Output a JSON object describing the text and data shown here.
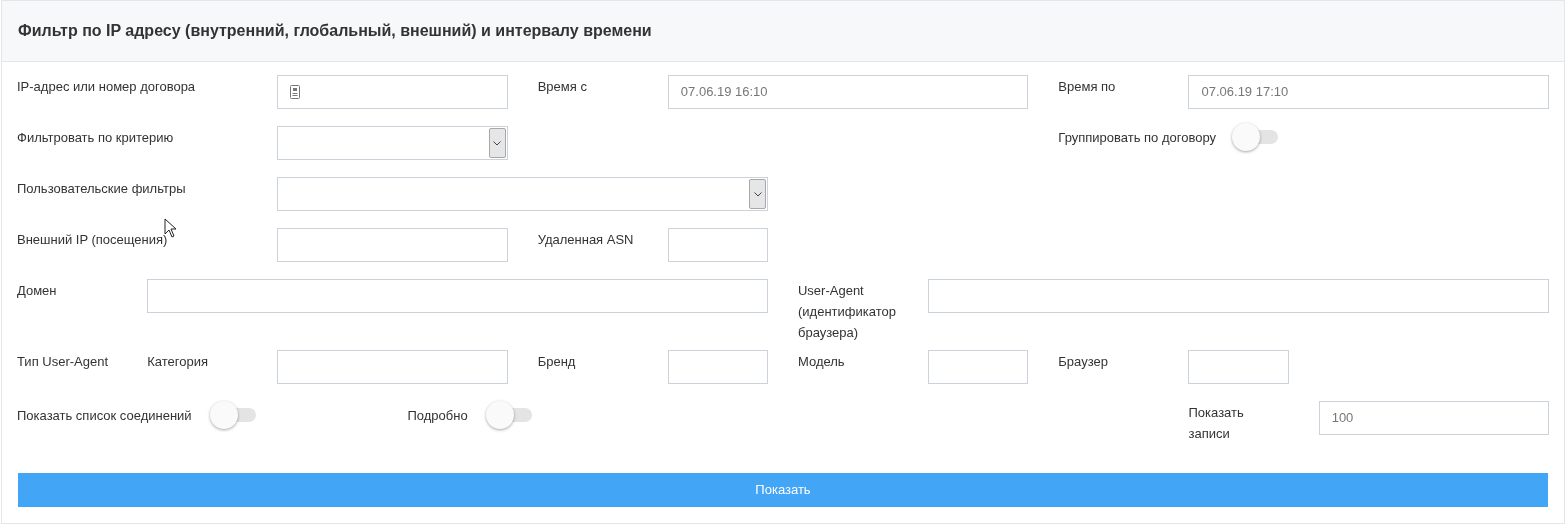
{
  "title": "Фильтр по IP адресу (внутренний, глобальный, внешний) и интервалу времени",
  "ip_or_contract": {
    "label": "IP-адрес или номер договора"
  },
  "time_from": {
    "label": "Время с",
    "value": "07.06.19 16:10"
  },
  "time_to": {
    "label": "Время по",
    "value": "07.06.19 17:10"
  },
  "filter_criterion": {
    "label": "Фильтровать по критерию"
  },
  "group_by_contract": {
    "label": "Группировать по договору",
    "on": false
  },
  "user_filters": {
    "label": "Пользовательские фильтры"
  },
  "external_ip": {
    "label": "Внешний IP (посещения)"
  },
  "remote_asn": {
    "label": "Удаленная ASN"
  },
  "domain": {
    "label": "Домен"
  },
  "user_agent": {
    "label": "User-Agent (идентификатор браузера)"
  },
  "ua_type": {
    "label": "Тип User-Agent"
  },
  "category": {
    "label": "Категория"
  },
  "brand": {
    "label": "Бренд"
  },
  "model": {
    "label": "Модель"
  },
  "browser": {
    "label": "Браузер"
  },
  "show_connections": {
    "label": "Показать список соединений",
    "on": false
  },
  "detailed": {
    "label": "Подробно",
    "on": false
  },
  "show_records": {
    "label": "Показать записи",
    "value": "100"
  },
  "submit_button": "Показать"
}
